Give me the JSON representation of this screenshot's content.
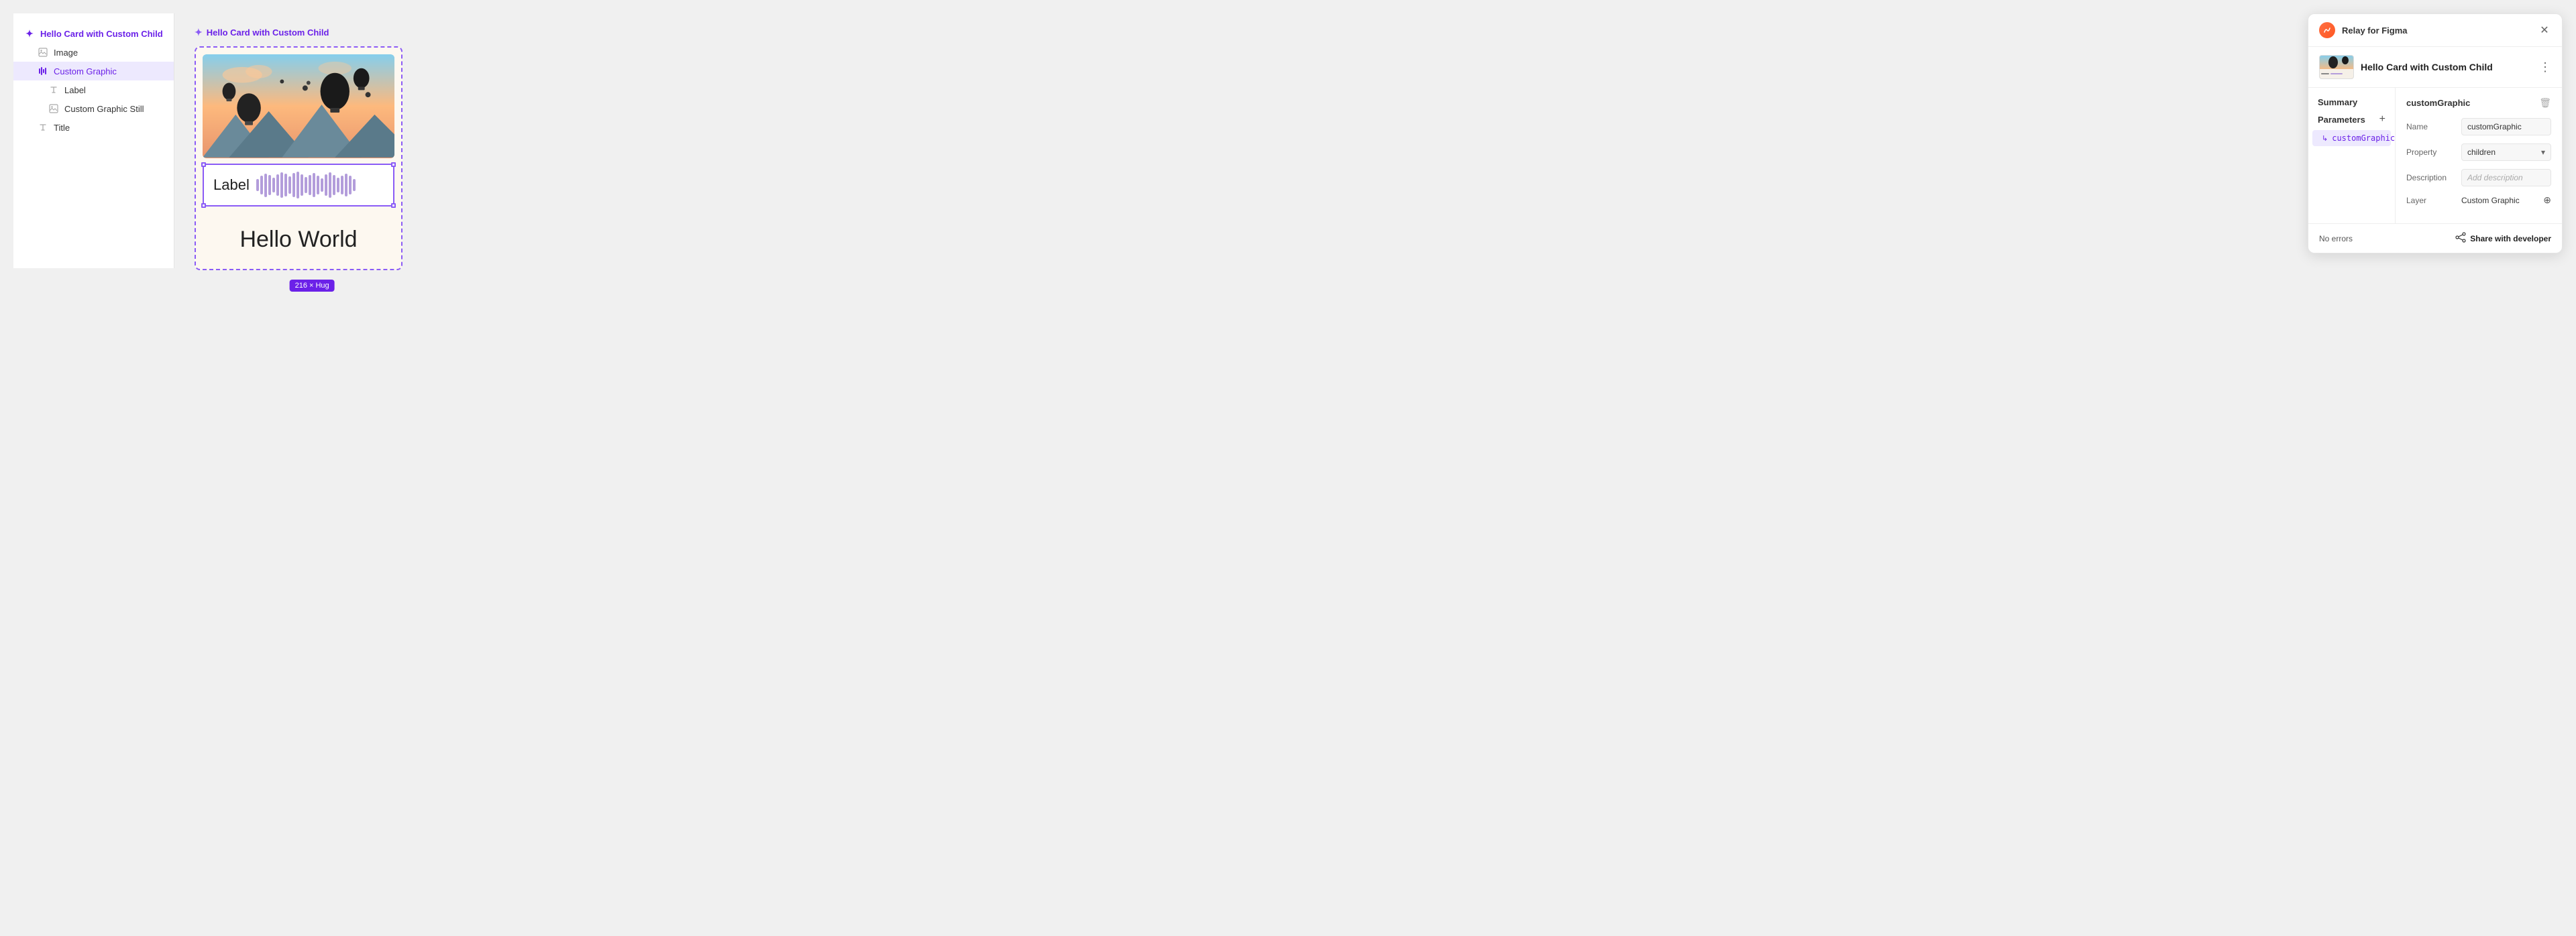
{
  "leftPanel": {
    "items": [
      {
        "id": "root",
        "label": "Hello Card with Custom Child",
        "icon": "move",
        "level": 0,
        "selected": false,
        "isRoot": true
      },
      {
        "id": "image",
        "label": "Image",
        "icon": "image",
        "level": 1,
        "selected": false
      },
      {
        "id": "custom-graphic",
        "label": "Custom Graphic",
        "icon": "bars",
        "level": 1,
        "selected": true
      },
      {
        "id": "label",
        "label": "Label",
        "icon": "text",
        "level": 2,
        "selected": false
      },
      {
        "id": "custom-graphic-still",
        "label": "Custom Graphic Still",
        "icon": "image",
        "level": 2,
        "selected": false
      },
      {
        "id": "title",
        "label": "Title",
        "icon": "text",
        "level": 1,
        "selected": false
      }
    ]
  },
  "centerPanel": {
    "title": "Hello Card with Custom Child",
    "sizeBadge": "216 × Hug",
    "labelText": "Label",
    "helloWorldText": "Hello World"
  },
  "rightPanel": {
    "appName": "Relay for Figma",
    "componentName": "Hello Card with Custom Child",
    "summaryLabel": "Summary",
    "parametersLabel": "Parameters",
    "paramItem": "customGraphic",
    "detail": {
      "topLabel": "customGraphic",
      "nameLabel": "Name",
      "nameValue": "customGraphic",
      "propertyLabel": "Property",
      "propertyValue": "children",
      "descriptionLabel": "Description",
      "descriptionPlaceholder": "Add description",
      "layerLabel": "Layer",
      "layerValue": "Custom Graphic"
    },
    "footer": {
      "noErrors": "No errors",
      "shareLabel": "Share with developer"
    }
  },
  "waveHeights": [
    18,
    28,
    35,
    30,
    22,
    32,
    38,
    34,
    26,
    36,
    40,
    32,
    24,
    30,
    36,
    28,
    20,
    32,
    38,
    30,
    22,
    28,
    34,
    28,
    18
  ]
}
